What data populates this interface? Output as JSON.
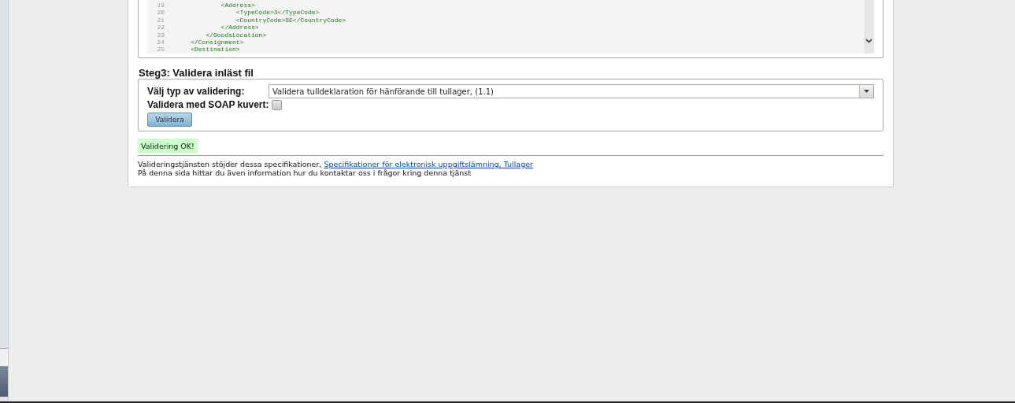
{
  "code_editor": {
    "lines": [
      {
        "number": "19",
        "code": "            <Address>"
      },
      {
        "number": "20",
        "code": "                <TypeCode>3</TypeCode>"
      },
      {
        "number": "21",
        "code": "                <CountryCode>SE</CountryCode>"
      },
      {
        "number": "22",
        "code": "            </Address>"
      },
      {
        "number": "23",
        "code": "        </GoodsLocation>"
      },
      {
        "number": "24",
        "code": "    </Consignment>"
      },
      {
        "number": "25",
        "code": "    <Destination>"
      }
    ]
  },
  "step3": {
    "heading": "Steg3: Validera inläst fil",
    "type_label": "Välj typ av validering:",
    "type_select": {
      "value": "Validera tulldeklaration för hänförande till tullager, (1.1)"
    },
    "soap_label": "Validera med SOAP kuvert:",
    "soap_checkbox": {
      "checked": false
    },
    "validate_button": "Validera"
  },
  "result_message": "Validering OK!",
  "footer": {
    "text": "Valideringstjänsten stöjder dessa specifikationer,",
    "link": "Specifikationer för elektronisk uppgiftslämning, Tullager",
    "info": "På denna sida hittar du även information hur du kontaktar oss i frågor kring denna tjänst"
  }
}
